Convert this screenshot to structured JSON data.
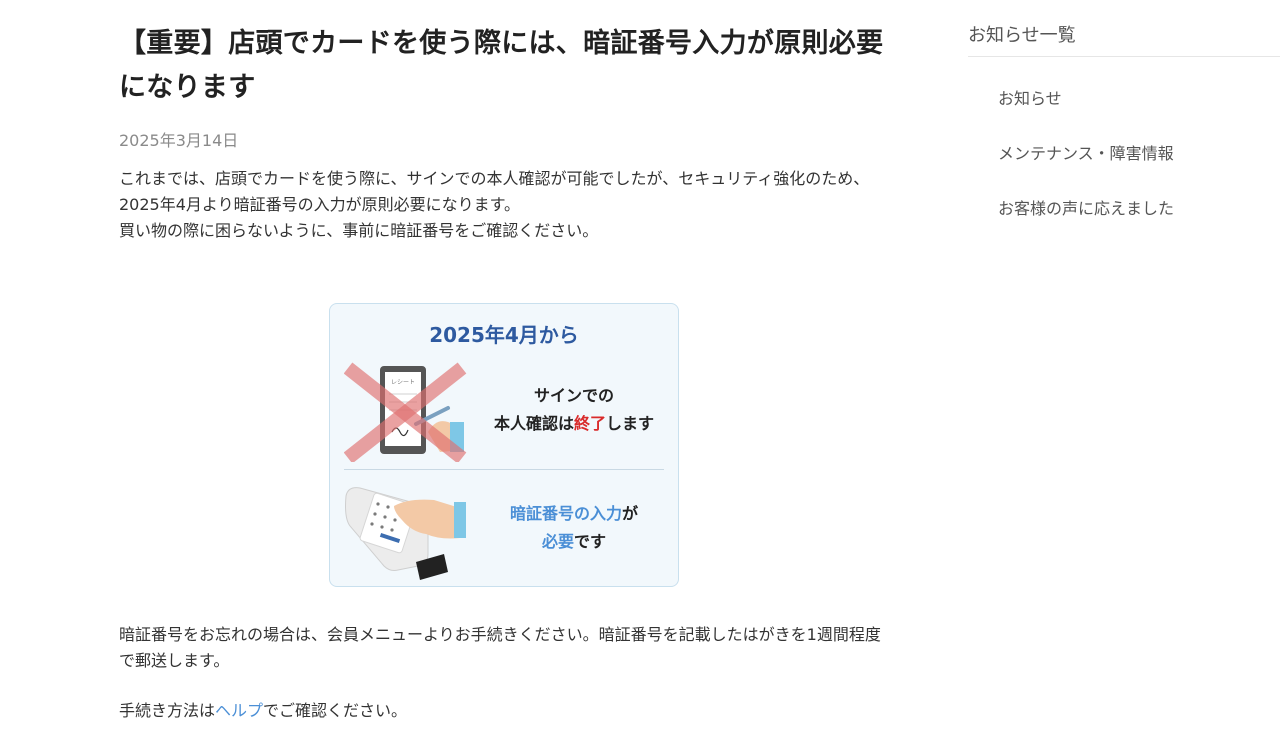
{
  "article": {
    "title": "【重要】店頭でカードを使う際には、暗証番号入力が原則必要になります",
    "date": "2025年3月14日",
    "intro_line1": "これまでは、店頭でカードを使う際に、サインでの本人確認が可能でしたが、セキュリティ強化のため、2025年4月より暗証番号の入力が原則必要になります。",
    "intro_line2": "買い物の際に困らないように、事前に暗証番号をご確認ください。",
    "forgot_text": "暗証番号をお忘れの場合は、会員メニューよりお手続きください。暗証番号を記載したはがきを1週間程度で郵送します。",
    "howto_prefix": "手続き方法は",
    "howto_link": "ヘルプ",
    "howto_suffix": "でご確認ください。"
  },
  "figure": {
    "heading": "2025年4月から",
    "receipt_label": "レシート",
    "sign_line1": "サインでの",
    "sign_line2_a": "本人確認は",
    "sign_line2_b": "終了",
    "sign_line2_c": "します",
    "pin_line1_a": "暗証番号の入力",
    "pin_line1_b": "が",
    "pin_line2_a": "必要",
    "pin_line2_b": "です"
  },
  "sidebar": {
    "heading": "お知らせ一覧",
    "items": [
      {
        "label": "お知らせ"
      },
      {
        "label": "メンテナンス・障害情報"
      },
      {
        "label": "お客様の声に応えました"
      }
    ]
  },
  "colors": {
    "accent_blue": "#4b8fd6",
    "heading_blue": "#2e5aa0",
    "alert_red": "#d92b2b",
    "card_bg": "#f2f8fc"
  }
}
